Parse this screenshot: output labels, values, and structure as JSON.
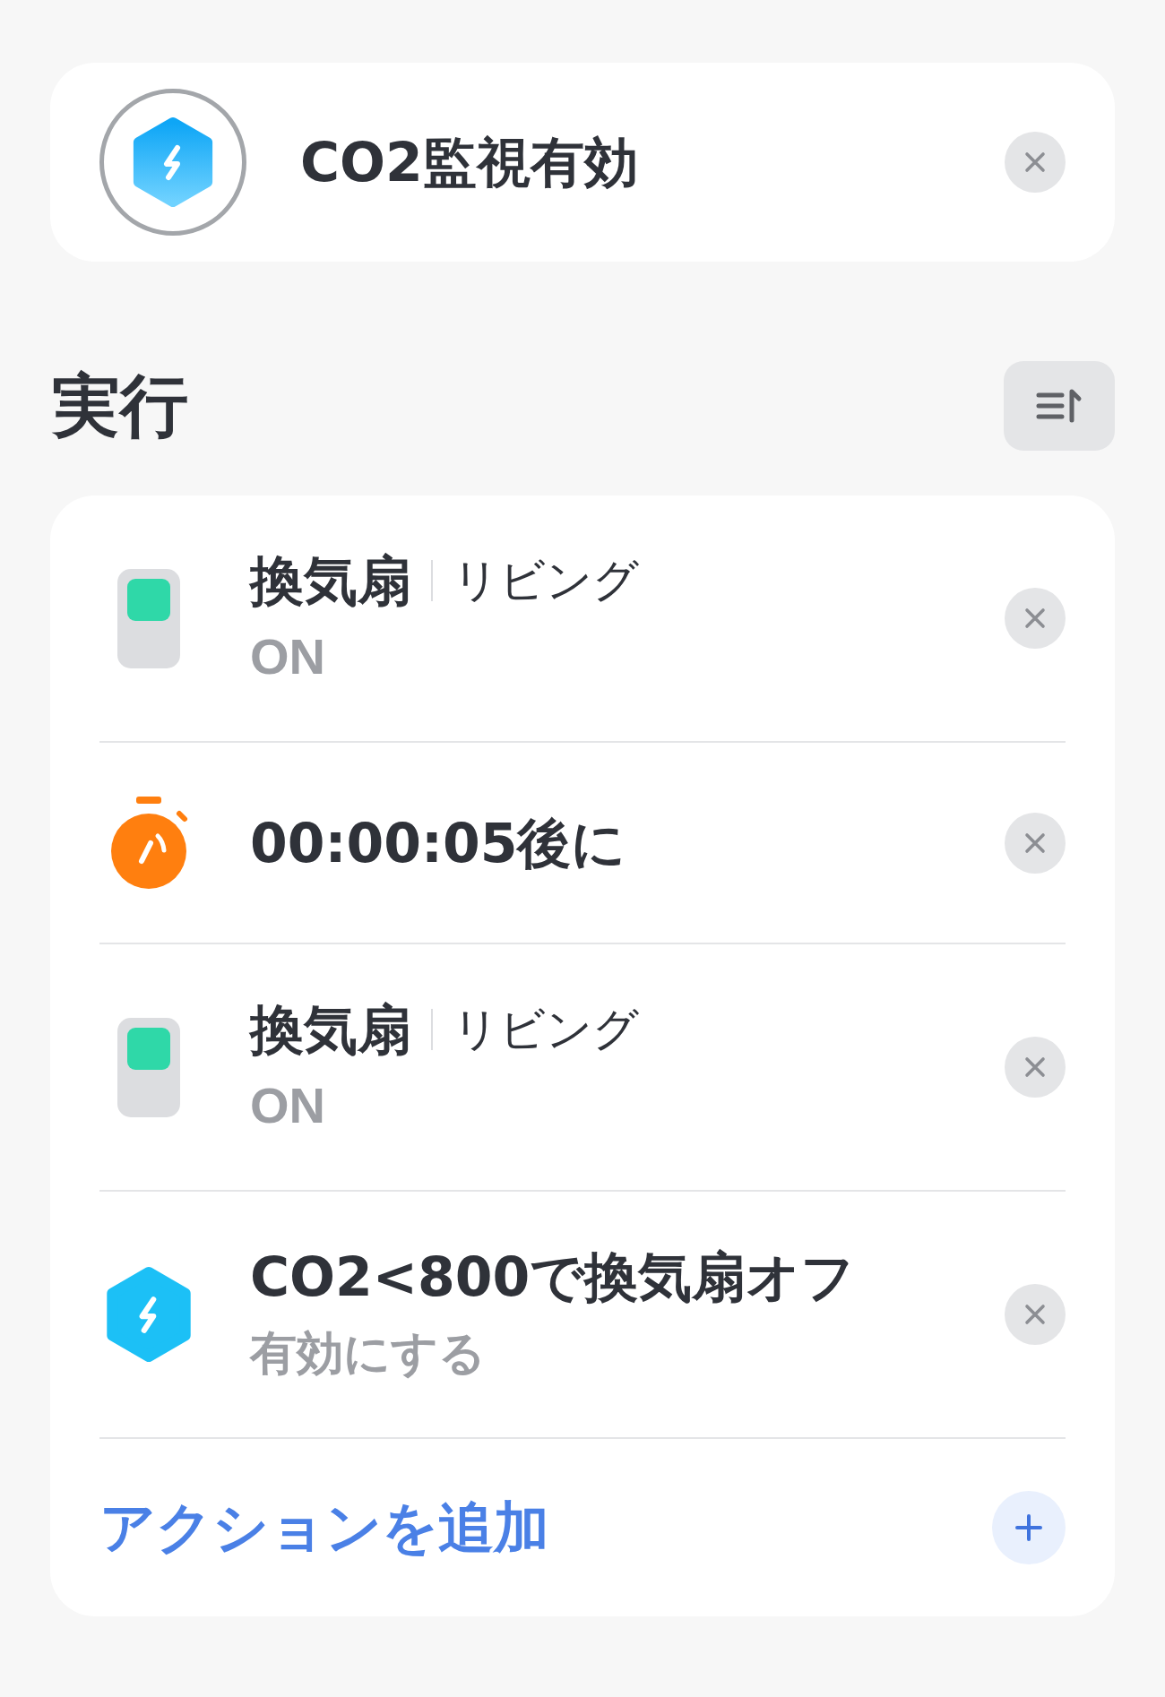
{
  "automation": {
    "title": "CO2監視有効"
  },
  "section": {
    "title": "実行"
  },
  "actions": [
    {
      "kind": "device",
      "name": "換気扇",
      "room": "リビング",
      "state": "ON",
      "on": true
    },
    {
      "kind": "delay",
      "text": "00:00:05後に"
    },
    {
      "kind": "device",
      "name": "換気扇",
      "room": "リビング",
      "state": "ON",
      "on": true
    },
    {
      "kind": "scene",
      "name": "CO2<800で換気扇オフ",
      "state": "有効にする"
    }
  ],
  "add_action": {
    "label": "アクションを追加"
  }
}
